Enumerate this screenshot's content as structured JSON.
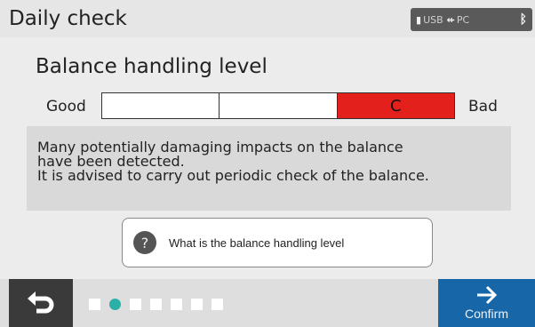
{
  "header": {
    "title": "Daily check",
    "status": {
      "usb_label": "USB",
      "pc_label": "PC",
      "usb_icon": "usb-icon",
      "pc_icon": "usb-plug-icon",
      "bluetooth_icon": "bluetooth-icon"
    }
  },
  "level": {
    "title": "Balance handling level",
    "good_label": "Good",
    "bad_label": "Bad",
    "segments": [
      "",
      "",
      "C"
    ],
    "active_index": 2,
    "active_color": "#e3201b"
  },
  "message": {
    "line1": "Many potentially damaging impacts on the balance",
    "line2": "have been detected.",
    "line3": "It is advised to carry out periodic check of the balance."
  },
  "help": {
    "icon": "question-icon",
    "icon_glyph": "?",
    "label": "What is the balance handling level"
  },
  "footer": {
    "back_icon": "return-arrow-icon",
    "confirm_label": "Confirm",
    "confirm_icon": "right-arrow-icon",
    "confirm_color": "#1767a8",
    "page_indicator": {
      "total": 7,
      "current": 2
    }
  }
}
